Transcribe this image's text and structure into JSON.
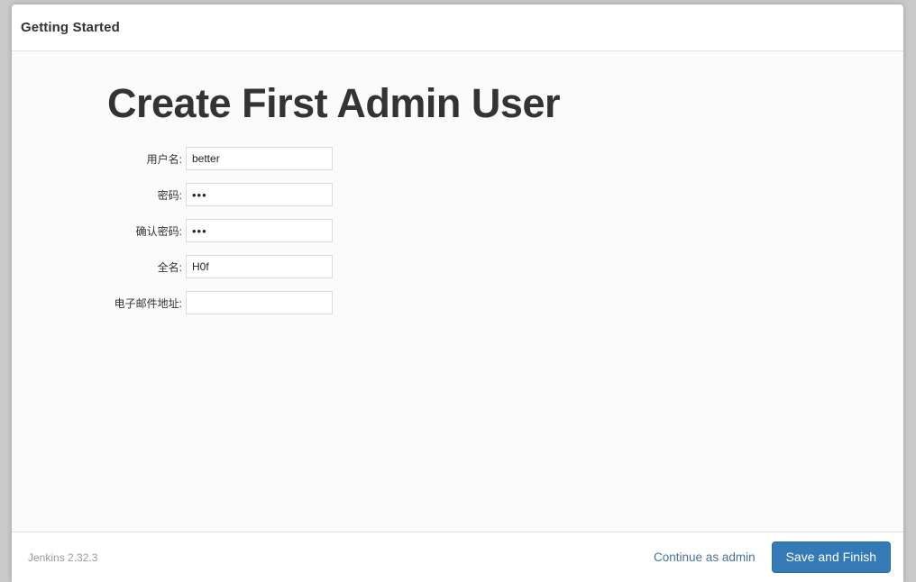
{
  "window": {
    "header_title": "Getting Started"
  },
  "setup": {
    "title": "Create First Admin User"
  },
  "form": {
    "fields": [
      {
        "name": "username",
        "label": "用户名:",
        "type": "text",
        "value": "better",
        "placeholder": ""
      },
      {
        "name": "password",
        "label": "密码:",
        "type": "password",
        "value": "•••",
        "placeholder": ""
      },
      {
        "name": "confirm-password",
        "label": "确认密码:",
        "type": "password",
        "value": "•••",
        "placeholder": ""
      },
      {
        "name": "fullname",
        "label": "全名:",
        "type": "text",
        "value": "H0f",
        "placeholder": ""
      },
      {
        "name": "email",
        "label": "电子邮件地址:",
        "type": "text",
        "value": "",
        "placeholder": ""
      }
    ]
  },
  "footer": {
    "version": "Jenkins 2.32.3",
    "continue_link": "Continue as admin",
    "save_button": "Save and Finish"
  },
  "colors": {
    "primary": "#337ab7",
    "primary_border": "#2e6da4",
    "link": "#4a7296",
    "page_background": "#c9c9c9",
    "panel_background": "#ffffff",
    "body_background": "#fbfbfb",
    "text": "#333333",
    "muted_text": "#999999",
    "input_border": "#dcdcdc"
  }
}
